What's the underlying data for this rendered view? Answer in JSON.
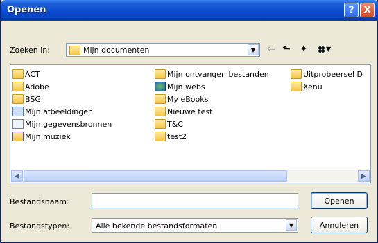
{
  "window": {
    "title": "Openen"
  },
  "titlebar": {
    "help_glyph": "?",
    "close_glyph": "X"
  },
  "lookin": {
    "label": "Zoeken in:",
    "value": "Mijn documenten"
  },
  "files": [
    {
      "name": "ACT",
      "icon": "folder-icon"
    },
    {
      "name": "Adobe",
      "icon": "folder-icon"
    },
    {
      "name": "BSG",
      "icon": "folder-icon"
    },
    {
      "name": "Mijn afbeeldingen",
      "icon": "pictures-folder-icon"
    },
    {
      "name": "Mijn gegevensbronnen",
      "icon": "data-sources-icon"
    },
    {
      "name": "Mijn muziek",
      "icon": "music-folder-icon"
    },
    {
      "name": "Mijn ontvangen bestanden",
      "icon": "folder-icon"
    },
    {
      "name": "Mijn webs",
      "icon": "webs-folder-icon"
    },
    {
      "name": "My eBooks",
      "icon": "folder-icon"
    },
    {
      "name": "Nieuwe test",
      "icon": "folder-icon"
    },
    {
      "name": "T&C",
      "icon": "folder-icon"
    },
    {
      "name": "test2",
      "icon": "folder-icon"
    },
    {
      "name": "Uitprobeersel D",
      "icon": "folder-icon"
    },
    {
      "name": "Xenu",
      "icon": "folder-icon"
    }
  ],
  "filename": {
    "label": "Bestandsnaam:",
    "value": ""
  },
  "filetype": {
    "label": "Bestandstypen:",
    "value": "Alle bekende bestandsformaten"
  },
  "buttons": {
    "open": "Openen",
    "cancel": "Annuleren"
  }
}
